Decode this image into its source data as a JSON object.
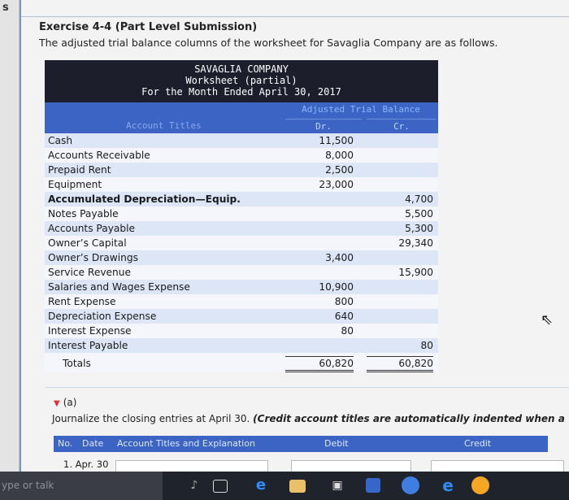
{
  "sidebar": {
    "letter": "s",
    "chevron": ">"
  },
  "exercise": {
    "title": "Exercise 4-4 (Part Level Submission)",
    "subtitle": "The adjusted trial balance columns of the worksheet for Savaglia Company are as follows."
  },
  "worksheet": {
    "company": "SAVAGLIA COMPANY",
    "name": "Worksheet (partial)",
    "period": "For the Month Ended April 30, 2017",
    "column_group": "Adjusted Trial Balance",
    "col_titles": "Account Titles",
    "col_dr": "Dr.",
    "col_cr": "Cr.",
    "rows": [
      {
        "title": "Cash",
        "dr": "11,500",
        "cr": ""
      },
      {
        "title": "Accounts Receivable",
        "dr": "8,000",
        "cr": ""
      },
      {
        "title": "Prepaid Rent",
        "dr": "2,500",
        "cr": ""
      },
      {
        "title": "Equipment",
        "dr": "23,000",
        "cr": ""
      },
      {
        "title": "Accumulated Depreciation—Equip.",
        "dr": "",
        "cr": "4,700"
      },
      {
        "title": "Notes Payable",
        "dr": "",
        "cr": "5,500"
      },
      {
        "title": "Accounts Payable",
        "dr": "",
        "cr": "5,300"
      },
      {
        "title": "Owner’s Capital",
        "dr": "",
        "cr": "29,340"
      },
      {
        "title": "Owner’s Drawings",
        "dr": "3,400",
        "cr": ""
      },
      {
        "title": "Service Revenue",
        "dr": "",
        "cr": "15,900"
      },
      {
        "title": "Salaries and Wages Expense",
        "dr": "10,900",
        "cr": ""
      },
      {
        "title": "Rent Expense",
        "dr": "800",
        "cr": ""
      },
      {
        "title": "Depreciation Expense",
        "dr": "640",
        "cr": ""
      },
      {
        "title": "Interest Expense",
        "dr": "80",
        "cr": ""
      },
      {
        "title": "Interest Payable",
        "dr": "",
        "cr": "80"
      }
    ],
    "totals": {
      "title": "Totals",
      "dr": "60,820",
      "cr": "60,820"
    }
  },
  "part_a": {
    "label": "(a)",
    "instruction_plain": "Journalize the closing entries at April 30. ",
    "instruction_em": "(Credit account titles are automatically indented when a"
  },
  "journal": {
    "headers": {
      "no": "No.",
      "date": "Date",
      "account": "Account Titles and Explanation",
      "debit": "Debit",
      "credit": "Credit"
    },
    "row1": {
      "num": "1.",
      "date": "Apr. 30"
    }
  },
  "taskbar": {
    "search_placeholder": "ype or talk"
  },
  "colors": {
    "header_band": "#3c64c4",
    "worksheet_header": "#1c1f2b",
    "row_stripe": "#dce6f7",
    "taskbar": "#1f232b"
  }
}
